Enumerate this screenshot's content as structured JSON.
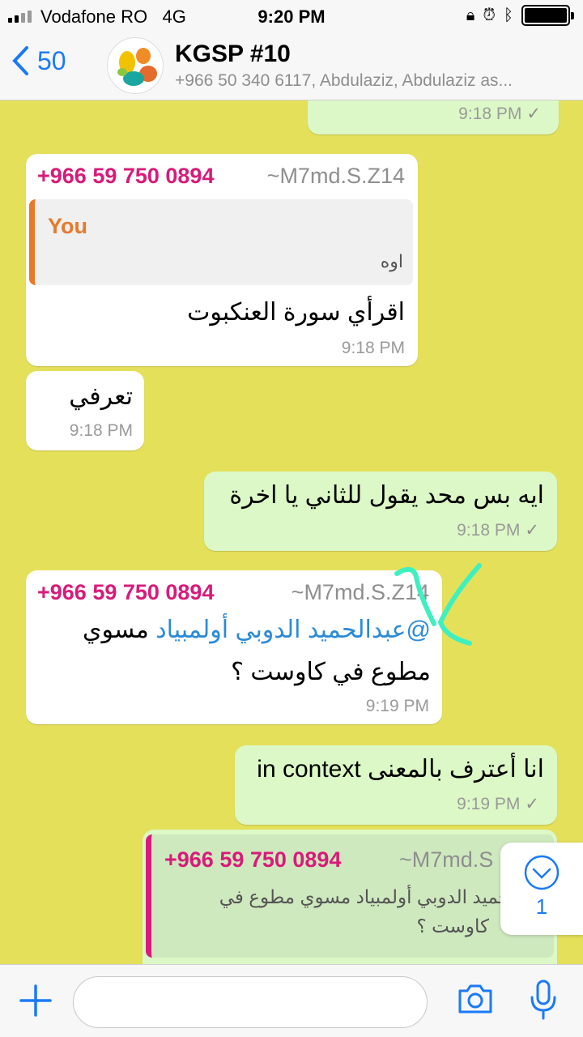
{
  "status": {
    "carrier": "Vodafone RO",
    "network": "4G",
    "time": "9:20 PM"
  },
  "header": {
    "back_count": "50",
    "title": "KGSP #10",
    "subtitle": "+966 50 340 6117, Abdulaziz, Abdulaziz as..."
  },
  "messages": {
    "m0": {
      "time": "9:18 PM"
    },
    "m1": {
      "sender": "+966 59 750 0894",
      "alias": "~M7md.S.Z14",
      "quote_sender": "You",
      "quote_text": "اوه",
      "text": "اقرأي سورة العنكبوت",
      "time": "9:18 PM"
    },
    "m2": {
      "text": "تعرفي",
      "time": "9:18 PM"
    },
    "m3": {
      "text": "ايه بس محد يقول للثاني يا اخرة",
      "time": "9:18 PM"
    },
    "m4": {
      "sender": "+966 59 750 0894",
      "alias": "~M7md.S.Z14",
      "mention": "@عبدالحميد الدوبي أولمبياد",
      "text_a": " مسوي",
      "text_b": "مطوع في كاوست ؟",
      "time": "9:19 PM"
    },
    "m5": {
      "text": "انا أعترف بالمعنى in context",
      "time": "9:19 PM"
    },
    "m6": {
      "sender": "+966 59 750 0894",
      "alias": "~M7md.S",
      "quote_line1": "الحميد الدوبي أولمبياد مسوي مطوع في",
      "quote_line2": "كاوست ؟"
    }
  },
  "scroll_badge": {
    "count": "1"
  },
  "colors": {
    "background": "#e5e05a",
    "outgoing": "#dcf8c6",
    "incoming": "#ffffff",
    "accent": "#1a7af8",
    "sender": "#d81b7a"
  }
}
